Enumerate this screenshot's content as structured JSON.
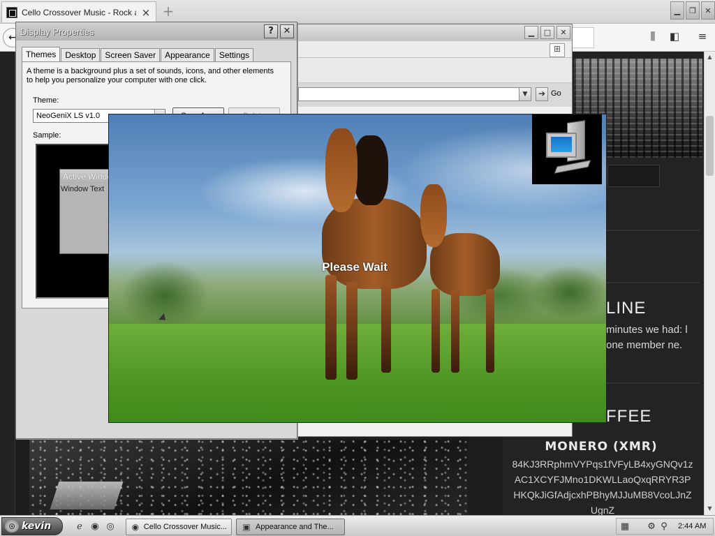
{
  "browser": {
    "tab_title": "Cello Crossover Music - Rock and M",
    "tab_close": "×",
    "new_tab": "+",
    "back": "←",
    "icons": {
      "library": "library-icon",
      "sidebar": "sidebar-icon",
      "menu": "hamburger-menu-icon"
    }
  },
  "webpage": {
    "online_heading": "LINE",
    "online_text": "minutes we had: l one member ne.",
    "coffee_heading": "FFEE",
    "monero_title": "MONERO (XMR)",
    "monero_address": "84KJ3RRphmVYPqs1fVFyLB4xyGNQv1zAC1XCYFJMno1DKWLLaoQxqRRYR3PHKQkJiGfAdjcxhPBhyMJJuMB8VcoLJnZUgnZ"
  },
  "control_panel": {
    "go_label": "Go"
  },
  "display_properties": {
    "title": "Display Properties",
    "help_btn": "?",
    "close_btn": "✕",
    "tabs": [
      "Themes",
      "Desktop",
      "Screen Saver",
      "Appearance",
      "Settings"
    ],
    "description": "A theme is a background plus a set of sounds, icons, and other elements to help you personalize your computer with one click.",
    "theme_label": "Theme:",
    "theme_value": "NeoGeniX LS v1.0",
    "save_as_btn": "Save As...",
    "delete_btn": "Delete",
    "sample_label": "Sample:",
    "sample_active_window": "Active Window",
    "sample_window_text": "Window Text"
  },
  "splash": {
    "message": "Please Wait"
  },
  "taskbar": {
    "start_label": "kevin",
    "tasks": [
      {
        "label": "Cello Crossover Music...",
        "icon": "firefox-icon"
      },
      {
        "label": "Appearance and The...",
        "icon": "control-panel-icon"
      }
    ],
    "clock": "2:44 AM"
  },
  "colors": {
    "page_bg": "#1d1d1d",
    "chrome": "#d6d6d6",
    "splash_text": "#ffffff"
  }
}
